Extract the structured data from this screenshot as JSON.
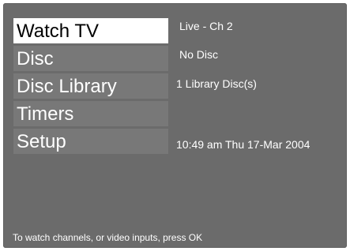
{
  "menu": {
    "items": [
      {
        "label": "Watch TV",
        "selected": true
      },
      {
        "label": "Disc",
        "selected": false
      },
      {
        "label": "Disc Library",
        "selected": false
      },
      {
        "label": "Timers",
        "selected": false
      },
      {
        "label": "Setup",
        "selected": false
      }
    ]
  },
  "info": {
    "watch_tv": "Live - Ch 2",
    "disc": "No Disc",
    "disc_library": "1 Library Disc(s)",
    "setup": "10:49 am Thu 17-Mar 2004"
  },
  "hint": "To watch channels, or video inputs, press OK",
  "colors": {
    "background": "#6b6b6b",
    "item": "#787878",
    "selected": "#ffffff",
    "text": "#ffffff",
    "selected_text": "#000000"
  }
}
